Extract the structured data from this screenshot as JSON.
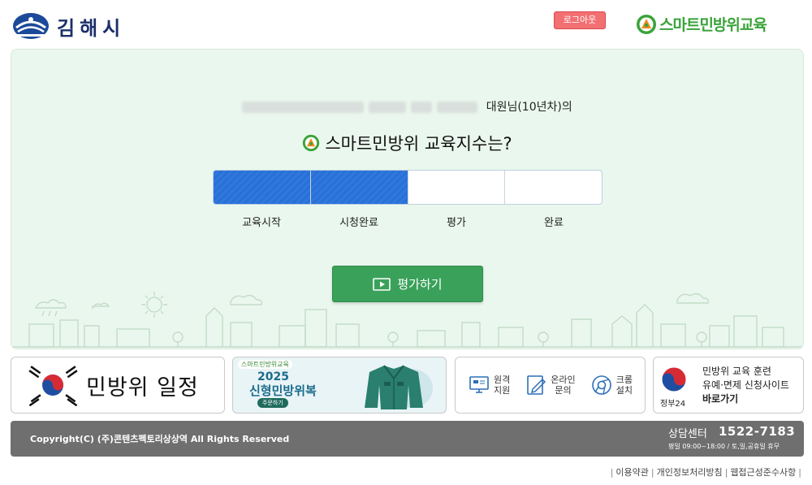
{
  "header": {
    "city_name": "김해시",
    "logout_label": "로그아웃",
    "brand_main": "스마트민방위교육"
  },
  "main": {
    "user_suffix": "대원님(10년차)의",
    "question": "스마트민방위 교육지수는?",
    "progress_percent": 50,
    "steps": [
      {
        "label": "교육시작"
      },
      {
        "label": "시청완료"
      },
      {
        "label": "평가"
      },
      {
        "label": "완료"
      }
    ],
    "eval_button_label": "평가하기"
  },
  "banners": {
    "schedule_label": "민방위 일정",
    "uniform": {
      "tag": "스마트민방위교육",
      "year": "2025",
      "title": "신형민방위복",
      "pill": "주문하기"
    },
    "services": [
      {
        "label_line1": "원격",
        "label_line2": "지원",
        "icon": "remote-support-icon"
      },
      {
        "label_line1": "온라인",
        "label_line2": "문의",
        "icon": "online-inquiry-icon"
      },
      {
        "label_line1": "크롬",
        "label_line2": "설치",
        "icon": "chrome-icon"
      }
    ],
    "gov24": {
      "label": "정부24",
      "line1": "민방위 교육 훈련",
      "line2": "유예·면제 신청사이트",
      "line3": "바로가기"
    }
  },
  "footer": {
    "copyright": "Copyright(C) (주)콘텐츠펙토리상상역 All Rights Reserved",
    "center_label": "상담센터",
    "center_phone": "1522-7183",
    "hours": "평일 09:00~18:00 / 토,일,공휴일 휴무"
  },
  "links": [
    {
      "label": "이용약관"
    },
    {
      "label": "개인정보처리방침"
    },
    {
      "label": "웹접근성준수사항"
    }
  ],
  "colors": {
    "brand_green": "#3aa33a",
    "progress_blue": "#2a6fd6",
    "button_green": "#3aa15a",
    "logout_red": "#f26f72",
    "panel_bg": "#eaf7ee",
    "footer_gray": "#6f6f6f"
  }
}
